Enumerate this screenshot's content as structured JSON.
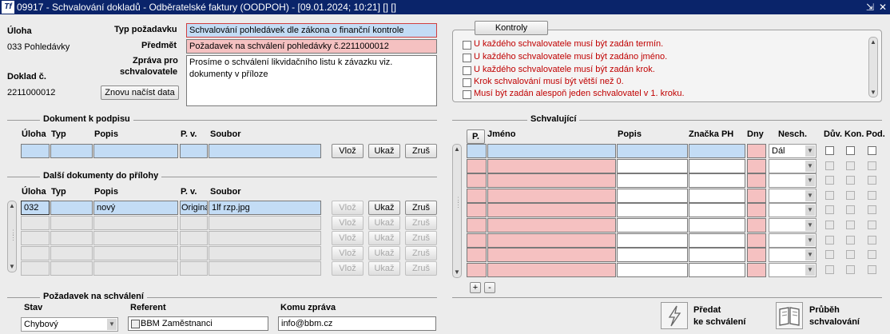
{
  "window": {
    "title": "09917 - Schvalování dokladů - Odběratelské faktury (OODPOH) - [09.01.2024; 10:21] [] []",
    "logo": "Tf",
    "controls": [
      "⇲",
      "✕"
    ]
  },
  "left": {
    "uloha_label": "Úloha",
    "uloha_value": "033 Pohledávky",
    "doklad_label": "Doklad č.",
    "doklad_value": "2211000012",
    "reload_button": "Znovu načíst data"
  },
  "request": {
    "typ_label": "Typ požadavku",
    "typ_value": "Schvalování pohledávek dle zákona o finanční kontrole",
    "predmet_label": "Předmět",
    "predmet_value": "Požadavek na schválení pohledávky č.2211000012",
    "zprava_label_1": "Zpráva pro",
    "zprava_label_2": "schvalovatele",
    "zprava_value": "Prosíme o schválení likvidačního listu k závazku viz. dokumenty v příloze"
  },
  "kontroly": {
    "button": "Kontroly",
    "items": [
      "U každého schvalovatele musí být zadán termín.",
      "U každého schvalovatele musí být zadáno jméno.",
      "U každého schvalovatele musí být zadán krok.",
      "Krok schvalování musí být větší než 0.",
      "Musí být zadán alespoň jeden schvalovatel v 1. kroku."
    ]
  },
  "dokument": {
    "section": "Dokument k podpisu",
    "columns": [
      "Úloha",
      "Typ",
      "Popis",
      "P. v.",
      "Soubor"
    ],
    "buttons": [
      "Vlož",
      "Ukaž",
      "Zruš"
    ]
  },
  "dalsi": {
    "section": "Další dokumenty do přílohy",
    "columns": [
      "Úloha",
      "Typ",
      "Popis",
      "P. v.",
      "Soubor"
    ],
    "rows": [
      {
        "uloha": "032",
        "typ": "",
        "popis": "nový",
        "pv": "Origina",
        "soubor": "1lf rzp.jpg"
      },
      {
        "uloha": "",
        "typ": "",
        "popis": "",
        "pv": "",
        "soubor": ""
      },
      {
        "uloha": "",
        "typ": "",
        "popis": "",
        "pv": "",
        "soubor": ""
      },
      {
        "uloha": "",
        "typ": "",
        "popis": "",
        "pv": "",
        "soubor": ""
      },
      {
        "uloha": "",
        "typ": "",
        "popis": "",
        "pv": "",
        "soubor": ""
      }
    ],
    "buttons": [
      "Vlož",
      "Ukaž",
      "Zruš"
    ]
  },
  "schvalujici": {
    "section": "Schvalující",
    "columns": [
      "P.",
      "Jméno",
      "Popis",
      "Značka PH",
      "Dny",
      "Nesch.",
      "Dův.",
      "Kon.",
      "Pod."
    ],
    "first_nesch": "Dál",
    "row_count": 9,
    "add": "+",
    "remove": "-"
  },
  "pozadavek": {
    "section": "Požadavek na schválení",
    "stav_label": "Stav",
    "stav_value": "Chybový",
    "referent_label": "Referent",
    "referent_value": "BBM Zaměstnanci",
    "komu_label": "Komu zpráva",
    "komu_value": "info@bbm.cz"
  },
  "actions": {
    "predat_1": "Předat",
    "predat_2": "ke schválení",
    "prubeh_1": "Průběh",
    "prubeh_2": "schvalování"
  }
}
